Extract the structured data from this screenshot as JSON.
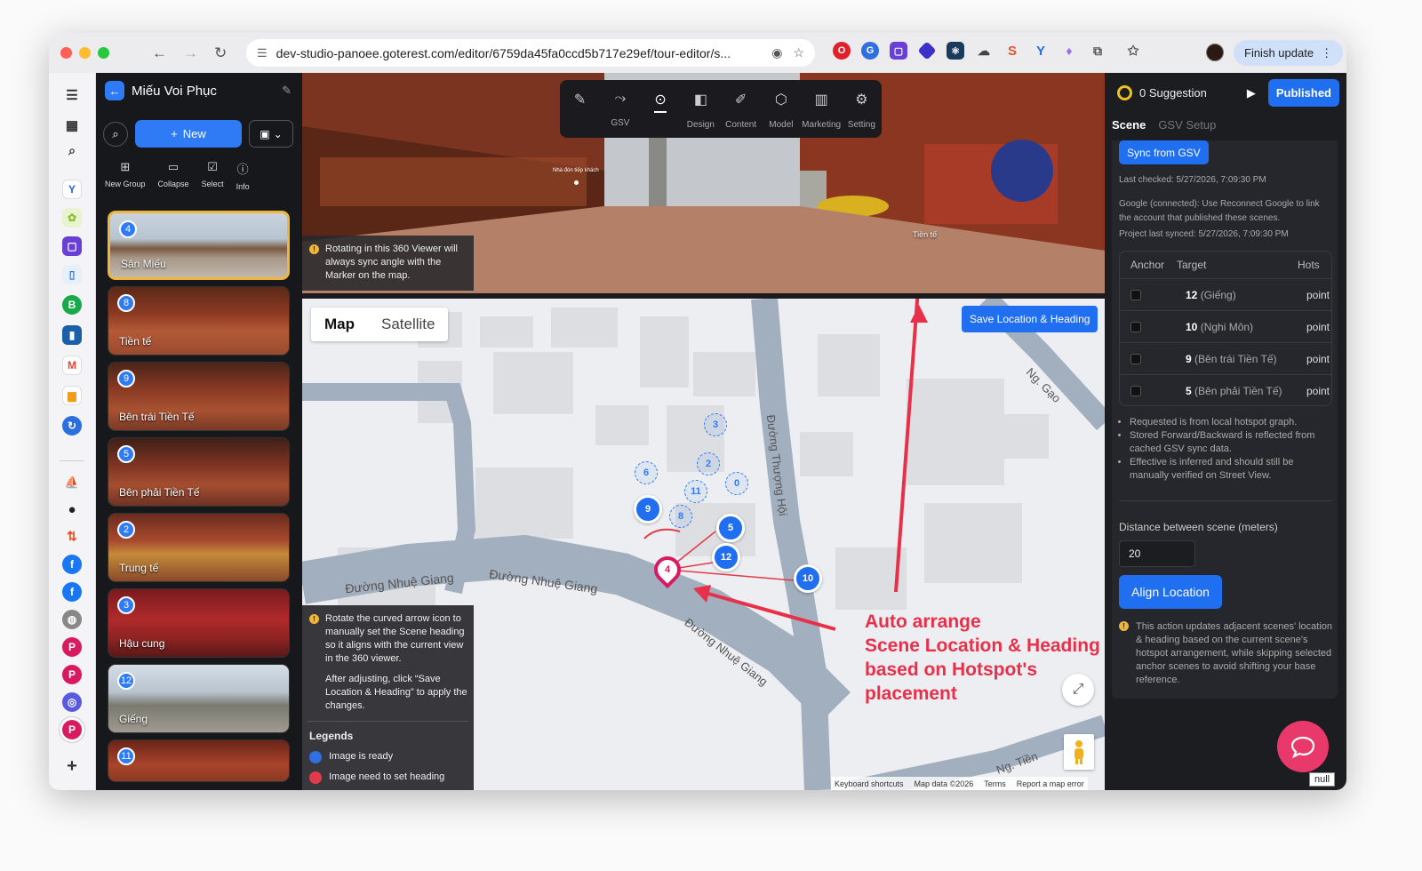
{
  "browser": {
    "url": "dev-studio-panoee.goterest.com/editor/6759da45fa0ccd5b717e29ef/tour-editor/s...",
    "finish_label": "Finish update"
  },
  "project": {
    "title": "Miếu Voi Phục"
  },
  "left": {
    "new_label": "New",
    "tools": [
      {
        "label": "New Group",
        "icon": "new-group-icon"
      },
      {
        "label": "Collapse",
        "icon": "folder-icon"
      },
      {
        "label": "Select",
        "icon": "checkbox-icon"
      },
      {
        "label": "Info",
        "icon": "info-icon"
      }
    ],
    "scenes": [
      {
        "num": "4",
        "name": "Sân Miếu"
      },
      {
        "num": "8",
        "name": "Tiền tế"
      },
      {
        "num": "9",
        "name": "Bên trái Tiền Tế"
      },
      {
        "num": "5",
        "name": "Bên phải Tiền Tế"
      },
      {
        "num": "2",
        "name": "Trung tế"
      },
      {
        "num": "3",
        "name": "Hậu cung"
      },
      {
        "num": "12",
        "name": "Giếng"
      },
      {
        "num": "11",
        "name": ""
      }
    ]
  },
  "viewer": {
    "tools": [
      {
        "label": "",
        "icon": "pencil-icon"
      },
      {
        "label": "GSV",
        "icon": "route-icon"
      },
      {
        "label": "",
        "icon": "location-pin-icon"
      },
      {
        "label": "Design",
        "icon": "design-icon"
      },
      {
        "label": "Content",
        "icon": "edit-icon"
      },
      {
        "label": "Model",
        "icon": "cube-icon"
      },
      {
        "label": "Marketing",
        "icon": "chart-icon"
      },
      {
        "label": "Setting",
        "icon": "gear-icon"
      }
    ],
    "note": "Rotating in this 360 Viewer will always sync angle with the Marker on the map.",
    "hotspot_label": "Tiền tế",
    "sign": "Nhà đón tiếp khách"
  },
  "map": {
    "tab_map": "Map",
    "tab_satellite": "Satellite",
    "save_label": "Save Location & Heading",
    "streets": [
      "Đường Nhuệ Giang",
      "Đường Nhuệ Giang",
      "Đường Nhuệ Giang",
      "Đường Thượng Hội",
      "Ng. Gạo",
      "Ng. Tiền"
    ],
    "note1": "Rotate the curved arrow icon to manually set the Scene heading so it aligns with the current view in the 360 viewer.",
    "note2": "After adjusting, click “Save Location & Heading” to apply the changes.",
    "legends_title": "Legends",
    "legend_ready": "Image is ready",
    "legend_heading": "Image need to set heading",
    "credits": [
      "Keyboard shortcuts",
      "Map data ©2026",
      "Terms",
      "Report a map error"
    ],
    "annotation": [
      "Auto arrange",
      "Scene Location & Heading",
      "based on Hotspot's",
      "placement"
    ],
    "markers": [
      {
        "n": "3"
      },
      {
        "n": "6"
      },
      {
        "n": "2"
      },
      {
        "n": "11"
      },
      {
        "n": "0"
      },
      {
        "n": "9"
      },
      {
        "n": "8"
      },
      {
        "n": "5"
      },
      {
        "n": "12"
      },
      {
        "n": "10"
      },
      {
        "n": "4"
      }
    ]
  },
  "right": {
    "suggestion": "0 Suggestion",
    "published": "Published",
    "tab_scene": "Scene",
    "tab_gsv": "GSV Setup",
    "sync": "Sync from GSV",
    "last_checked": "Last checked: 5/27/2026, 7:09:30 PM",
    "google": "Google (connected): Use Reconnect Google to link the account that published these scenes.",
    "project_synced": "Project last synced: 5/27/2026, 7:09:30 PM",
    "table": {
      "headers": [
        "Anchor",
        "Target",
        "Hots"
      ],
      "rows": [
        {
          "num": "12",
          "name": "(Giếng)",
          "hot": "point"
        },
        {
          "num": "10",
          "name": "(Nghi Môn)",
          "hot": "point"
        },
        {
          "num": "9",
          "name": "(Bên trái Tiền Tế)",
          "hot": "point"
        },
        {
          "num": "5",
          "name": "(Bên phải Tiền Tế)",
          "hot": "point"
        }
      ]
    },
    "bullets": [
      "Requested is from local hotspot graph.",
      "Stored Forward/Backward is reflected from cached GSV sync data.",
      "Effective is inferred and should still be manually verified on Street View."
    ],
    "distance_label": "Distance between scene (meters)",
    "distance_value": "20",
    "align_label": "Align Location",
    "align_note": "This action updates adjacent scenes' location & heading based on the current scene's hotspot arrangement, while skipping selected anchor scenes to avoid shifting your base reference."
  },
  "colors": {
    "accent": "#1f6ff0",
    "selected": "#f0b53b",
    "annotation": "#e8304a",
    "marker": "#1f6ff0",
    "current": "#d81b60"
  },
  "chat": {
    "null_label": "null"
  }
}
